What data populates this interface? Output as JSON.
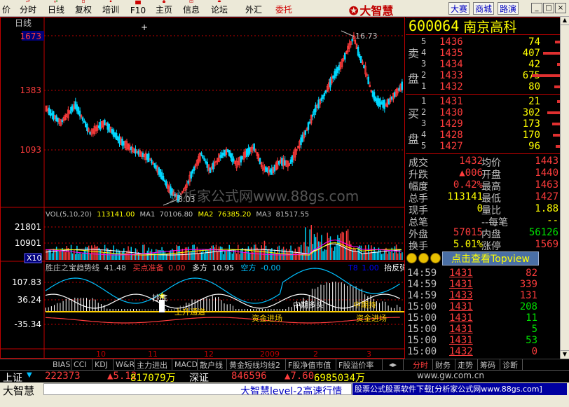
{
  "menu": [
    {
      "label": "价",
      "color": "#000"
    },
    {
      "label": "分时",
      "color": "#000"
    },
    {
      "label": "日线",
      "color": "#000"
    },
    {
      "label": "复权",
      "color": "#000"
    },
    {
      "label": "培训",
      "color": "#000"
    },
    {
      "label": "F10",
      "color": "#000"
    },
    {
      "label": "主页",
      "color": "#000"
    },
    {
      "label": "信息",
      "color": "#000"
    },
    {
      "label": "论坛",
      "color": "#000"
    },
    {
      "label": "外汇",
      "color": "#000"
    },
    {
      "label": "委托",
      "color": "#d00000"
    }
  ],
  "logo": "大智慧",
  "right_buttons": [
    "大赛",
    "商城",
    "路演"
  ],
  "window_buttons": [
    "_",
    "□",
    "×"
  ],
  "chart": {
    "period_label": "日线",
    "price_ticks": [
      "1673",
      "1383",
      "1093"
    ],
    "high_label": "16.73",
    "low_label": "8.03",
    "vol_indicator": {
      "name": "VOL(5,10,20)",
      "value": "113141.00",
      "ma1_label": "MA1",
      "ma1": "70106.80",
      "ma2_label": "MA2",
      "ma2": "76385.20",
      "ma3_label": "MA3",
      "ma3": "81517.55"
    },
    "vol_ticks": [
      "21801",
      "10901"
    ],
    "vol_unit": "X10",
    "ind_title": "胜庄之宝趋势线",
    "ind_value": "41.48",
    "ind_b1": "买点准备",
    "ind_b1v": "0.00",
    "ind_b2": "多方",
    "ind_b2v": "10.95",
    "ind_b3": "空方",
    "ind_b3v": "-0.00",
    "ind_t": "T8",
    "ind_t2": "1.00",
    "ind_tail": "抬反弹",
    "ind_ticks": [
      "107.83",
      "36.24",
      "-35.34"
    ],
    "ind_annots": [
      "抄底",
      "上升通道",
      "资金进场",
      "中期多头",
      "资金进场",
      "中期持"
    ],
    "x_ticks": [
      "10",
      "11",
      "12",
      "2009",
      "2",
      "3"
    ]
  },
  "stock": {
    "code": "600064",
    "name": "南京高科"
  },
  "orderbook": {
    "sell_label": "卖 盘",
    "buy_label": "买 盘",
    "sell": [
      {
        "lv": "5",
        "price": "1436",
        "vol": "74"
      },
      {
        "lv": "4",
        "price": "1435",
        "vol": "407"
      },
      {
        "lv": "3",
        "price": "1434",
        "vol": "42"
      },
      {
        "lv": "2",
        "price": "1433",
        "vol": "675"
      },
      {
        "lv": "1",
        "price": "1432",
        "vol": "80"
      }
    ],
    "buy": [
      {
        "lv": "1",
        "price": "1431",
        "vol": "21"
      },
      {
        "lv": "2",
        "price": "1430",
        "vol": "302"
      },
      {
        "lv": "3",
        "price": "1429",
        "vol": "173"
      },
      {
        "lv": "4",
        "price": "1428",
        "vol": "170"
      },
      {
        "lv": "5",
        "price": "1427",
        "vol": "96"
      }
    ]
  },
  "quote": [
    {
      "k1": "成交",
      "v1": "1432",
      "c1": "#ff3c3c",
      "k2": "均价",
      "v2": "1443",
      "c2": "#ff3c3c"
    },
    {
      "k1": "升跌",
      "v1": "▲006",
      "c1": "#ff3c3c",
      "k2": "开盘",
      "v2": "1440",
      "c2": "#ff3c3c"
    },
    {
      "k1": "幅度",
      "v1": "0.42%",
      "c1": "#ff3c3c",
      "k2": "最高",
      "v2": "1463",
      "c2": "#ff3c3c"
    },
    {
      "k1": "总手",
      "v1": "113141",
      "c1": "#ffff00",
      "k2": "最低",
      "v2": "1427",
      "c2": "#ff3c3c"
    },
    {
      "k1": "现手",
      "v1": "0",
      "c1": "#ffff00",
      "k2": "量比",
      "v2": "1.88",
      "c2": "#ffff00"
    },
    {
      "k1": "总笔",
      "v1": "",
      "c1": "#ffff00",
      "k2": "--每笔",
      "v2": "--",
      "c2": "#ffff00"
    },
    {
      "k1": "外盘",
      "v1": "57015",
      "c1": "#ff3c3c",
      "k2": "内盘",
      "v2": "56126",
      "c2": "#00e000"
    },
    {
      "k1": "换手",
      "v1": "5.01%",
      "c1": "#ffff00",
      "k2": "涨停",
      "v2": "1569",
      "c2": "#ff3c3c"
    }
  ],
  "topview_label": "点击查看Topview",
  "ticks": [
    {
      "t": "14:59",
      "p": "1431",
      "v": "82",
      "c": "#ff3c3c"
    },
    {
      "t": "14:59",
      "p": "1431",
      "v": "339",
      "c": "#ff3c3c"
    },
    {
      "t": "14:59",
      "p": "1433",
      "v": "131",
      "c": "#ff3c3c"
    },
    {
      "t": "15:00",
      "p": "1431",
      "v": "208",
      "c": "#00e000"
    },
    {
      "t": "15:00",
      "p": "1431",
      "v": "11",
      "c": "#00e000"
    },
    {
      "t": "15:00",
      "p": "1431",
      "v": "5",
      "c": "#00e000"
    },
    {
      "t": "15:00",
      "p": "1431",
      "v": "53",
      "c": "#00e000"
    },
    {
      "t": "15:00",
      "p": "1432",
      "v": "0",
      "c": "#ff3c3c"
    }
  ],
  "indicator_tabs": [
    "BIAS",
    "CCI",
    "KDJ",
    "W&R",
    "主力进出",
    "MACD",
    "散户线",
    "黄金短线均线2",
    "F股净值市值",
    "F股溢价率"
  ],
  "view_tabs": [
    "分时",
    "财务",
    "走势",
    "筹码",
    "诊断"
  ],
  "website": "www.gw.com.cn",
  "status1": {
    "index1": "上证",
    "v1": "222373",
    "chg1": "▲5.12",
    "amt1": "817079万",
    "index2": "深证",
    "v2": "846596",
    "chg2": "▲7.60",
    "amt2": "6985034万"
  },
  "status2": {
    "brand": "大智慧",
    "scroll": "大智慧level-2高速行情",
    "ad": "股票公式股票软件下载[分析家公式网www.88gs.com]"
  },
  "watermark": "分析家公式网www.88gs.com"
}
